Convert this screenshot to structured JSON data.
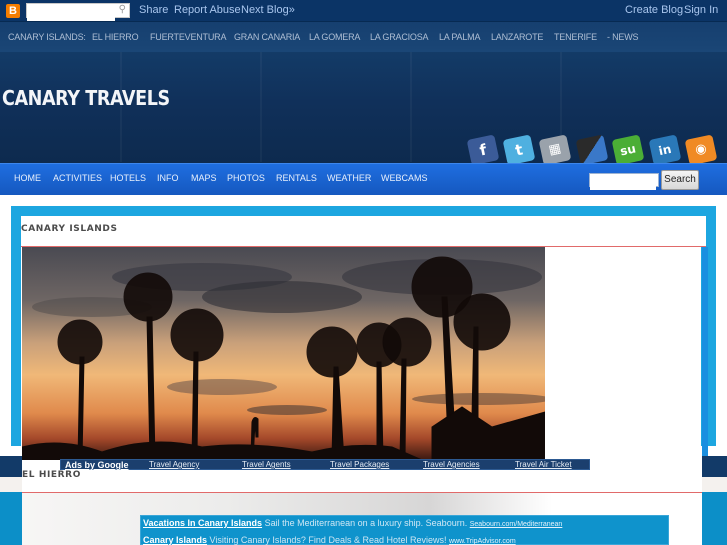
{
  "navbar": {
    "logo": "B",
    "search_placeholder": "",
    "links_left": [
      "Share",
      "Report Abuse",
      "Next Blog»"
    ],
    "links_right": [
      "Create Blog",
      "Sign In"
    ]
  },
  "island_nav": {
    "items": [
      "CANARY ISLANDS:",
      "EL HIERRO",
      "FUERTEVENTURA",
      "GRAN CANARIA",
      "LA GOMERA",
      "LA GRACIOSA",
      "LA PALMA",
      "LANZAROTE",
      "TENERIFE",
      "- NEWS"
    ]
  },
  "header": {
    "title": "CANARY TRAVELS",
    "social": [
      {
        "name": "facebook",
        "glyph": "f",
        "color": "#3b5b98"
      },
      {
        "name": "twitter",
        "glyph": "t",
        "color": "#4fb0e0"
      },
      {
        "name": "myspace",
        "glyph": "▦",
        "color": "#9aa2ab"
      },
      {
        "name": "delicious",
        "glyph": "◧",
        "color": "#3a6fb8"
      },
      {
        "name": "stumbleupon",
        "glyph": "su",
        "color": "#4bae36"
      },
      {
        "name": "linkedin",
        "glyph": "in",
        "color": "#2a78b8"
      },
      {
        "name": "rss",
        "glyph": "◉",
        "color": "#f08a24"
      }
    ]
  },
  "main_nav": {
    "items": [
      "HOME",
      "ACTIVITIES",
      "HOTELS",
      "INFO",
      "MAPS",
      "PHOTOS",
      "RENTALS",
      "WEATHER",
      "WEBCAMS"
    ],
    "search_value": "",
    "search_button": "Search"
  },
  "posts": [
    {
      "title": "CANARY ISLANDS",
      "image": "sunset-palm-trees"
    },
    {
      "title": "EL HIERRO"
    }
  ],
  "ads_bar": {
    "label": "Ads by Google",
    "links": [
      "Travel Agency",
      "Travel Agents",
      "Travel Packages",
      "Travel Agencies",
      "Travel Air Ticket"
    ]
  },
  "ad_unit": {
    "ads": [
      {
        "title": "Vacations In Canary Islands",
        "text": "Sail the Mediterranean on a luxury ship. Seabourn.",
        "url": "Seabourn.com/Mediterranean"
      },
      {
        "title": "Canary Islands",
        "text": "Visiting Canary Islands? Find Deals & Read Hotel Reviews!",
        "url": "www.TripAdvisor.com"
      }
    ]
  }
}
